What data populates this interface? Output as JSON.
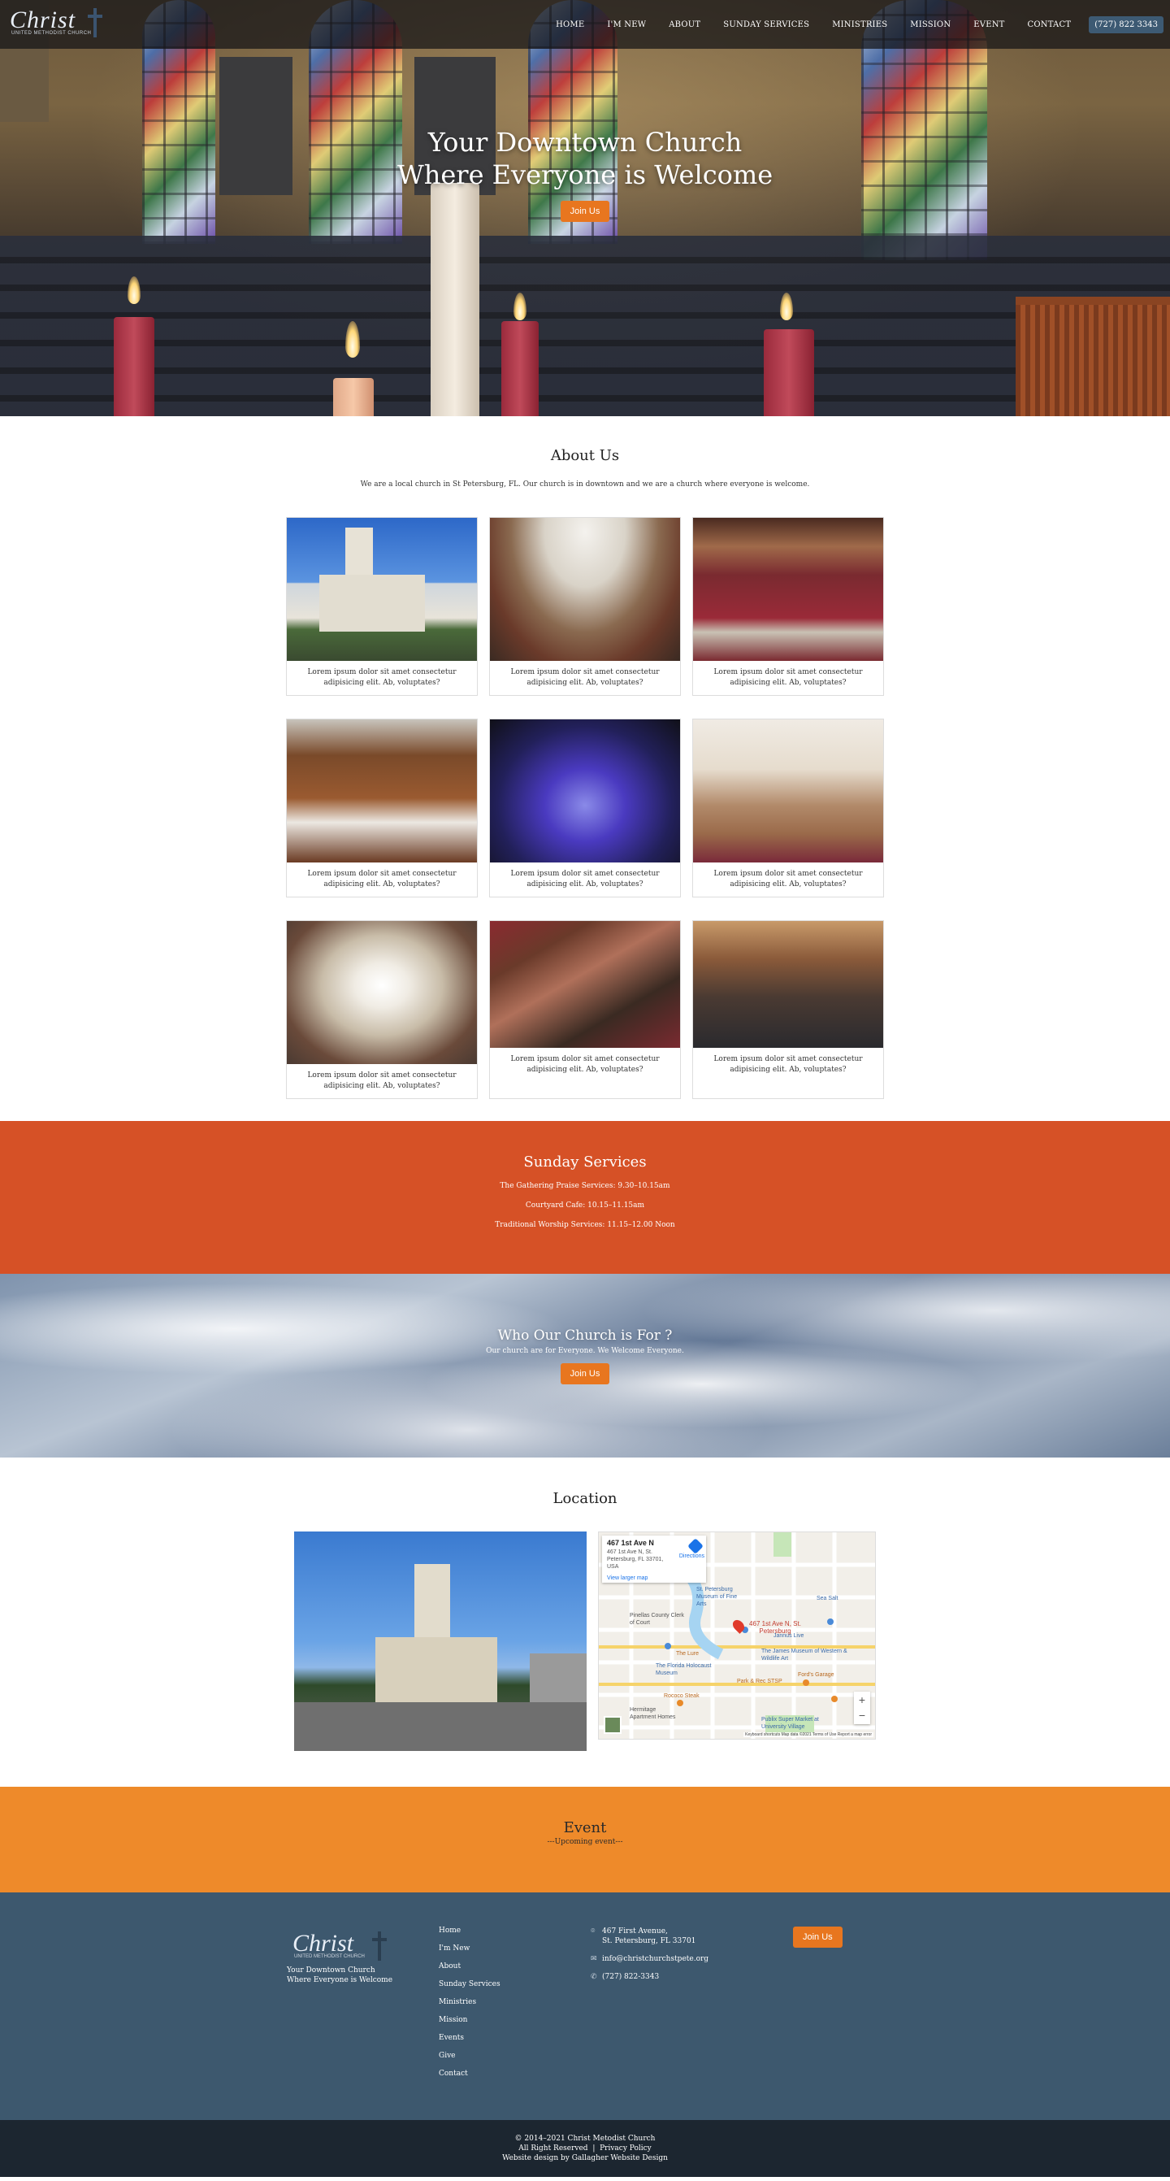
{
  "nav": {
    "logo_text": "Christ",
    "logo_subtitle": "UNITED METHODIST CHURCH",
    "items": [
      {
        "label": "HOME"
      },
      {
        "label": "I'M NEW"
      },
      {
        "label": "ABOUT"
      },
      {
        "label": "SUNDAY SERVICES"
      },
      {
        "label": "MINISTRIES"
      },
      {
        "label": "MISSION"
      },
      {
        "label": "EVENT"
      },
      {
        "label": "CONTACT"
      }
    ],
    "phone": "(727) 822 3343"
  },
  "hero": {
    "title_line1": "Your Downtown Church",
    "title_line2": "Where Everyone is Welcome",
    "button": "Join Us"
  },
  "about": {
    "title": "About Us",
    "description": "We are a local church in St Petersburg, FL. Our church is in downtown and we are a church where everyone is welcome.",
    "cards": [
      {
        "text": "Lorem ipsum dolor sit amet consectetur adipisicing elit. Ab, voluptates?"
      },
      {
        "text": "Lorem ipsum dolor sit amet consectetur adipisicing elit. Ab, voluptates?"
      },
      {
        "text": "Lorem ipsum dolor sit amet consectetur adipisicing elit. Ab, voluptates?"
      },
      {
        "text": "Lorem ipsum dolor sit amet consectetur adipisicing elit. Ab, voluptates?"
      },
      {
        "text": "Lorem ipsum dolor sit amet consectetur adipisicing elit. Ab, voluptates?"
      },
      {
        "text": "Lorem ipsum dolor sit amet consectetur adipisicing elit. Ab, voluptates?"
      },
      {
        "text": "Lorem ipsum dolor sit amet consectetur adipisicing elit. Ab, voluptates?"
      },
      {
        "text": "Lorem ipsum dolor sit amet consectetur adipisicing elit. Ab, voluptates?"
      },
      {
        "text": "Lorem ipsum dolor sit amet consectetur adipisicing elit. Ab, voluptates?"
      }
    ]
  },
  "sunday": {
    "title": "Sunday Services",
    "services": [
      "The Gathering Praise Services: 9.30–10.15am",
      "Courtyard Cafe: 10.15–11.15am",
      "Traditional Worship Services: 11.15–12.00 Noon"
    ]
  },
  "who": {
    "title": "Who Our Church is For ?",
    "subtitle": "Our church are for Everyone. We Welcome Everyone.",
    "button": "Join Us"
  },
  "location": {
    "title": "Location",
    "map": {
      "place": "467 1st Ave N",
      "address": "467 1st Ave N, St. Petersburg, FL 33701, USA",
      "directions": "Directions",
      "larger_map": "View larger map",
      "pin_label": "467 1st Ave N, St. Petersburg",
      "labels": [
        "St. Petersburg Museum of Fine Arts",
        "Sea Salt",
        "Pinellas County Clerk of Court",
        "The James Museum of Western & Wildlife Art",
        "The Florida Holocaust Museum",
        "Park & Rec STSP",
        "Rococo Steak",
        "Hermitage Apartment Homes",
        "Publix Super Market at University Village",
        "Jannus Live",
        "The Lure",
        "Ford's Garage"
      ],
      "footer": "Keyboard shortcuts   Map data ©2021   Terms of Use   Report a map error"
    }
  },
  "event": {
    "title": "Event",
    "subtitle": "---Upcoming event---"
  },
  "footer": {
    "logo_text": "Christ",
    "logo_subtitle": "UNITED METHODIST CHURCH",
    "tagline": "Your Downtown Church Where Everyone is Welcome",
    "links": [
      "Home",
      "I'm New",
      "About",
      "Sunday Services",
      "Ministries",
      "Mission",
      "Events",
      "Give",
      "Contact"
    ],
    "address_line1": "467 First Avenue,",
    "address_line2": "St. Petersburg, FL 33701",
    "email": "info@christchurchstpete.org",
    "phone": "(727) 822-3343",
    "button": "Join Us"
  },
  "bottom": {
    "copyright": "© 2014–2021 Christ Metodist Church",
    "rights": "All Right Reserved",
    "privacy": "Privacy Policy",
    "credit": "Website design by Gallagher Website Design"
  }
}
